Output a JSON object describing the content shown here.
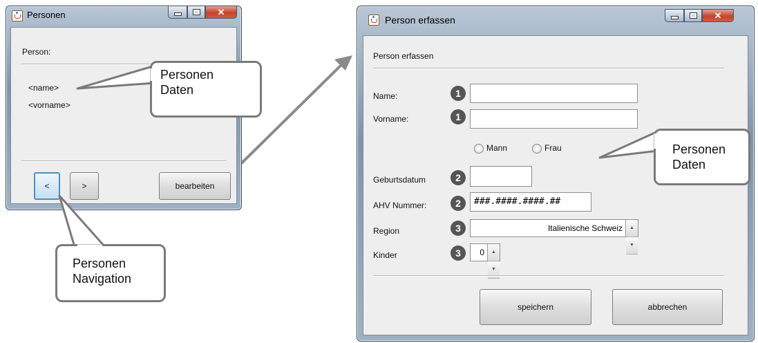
{
  "window1": {
    "title": "Personen",
    "person_label": "Person:",
    "name_placeholder": "<name>",
    "vorname_placeholder": "<vorname>",
    "prev_label": "<",
    "next_label": ">",
    "edit_label": "bearbeiten"
  },
  "window2": {
    "title": "Person erfassen",
    "heading": "Person erfassen",
    "fields": {
      "name_label": "Name:",
      "vorname_label": "Vorname:",
      "mann_label": "Mann",
      "frau_label": "Frau",
      "geburtsdatum_label": "Geburtsdatum",
      "ahv_label": "AHV Nummer:",
      "ahv_value": "###.####.####.##",
      "region_label": "Region",
      "region_value": "Italienische Schweiz",
      "kinder_label": "Kinder",
      "kinder_value": "0"
    },
    "badges": {
      "name": "1",
      "vorname": "1",
      "geburtsdatum": "2",
      "ahv": "2",
      "region": "3",
      "kinder": "3"
    },
    "save_label": "speichern",
    "cancel_label": "abbrechen"
  },
  "callouts": {
    "personen_daten_left": [
      "Personen",
      "Daten"
    ],
    "personen_navigation": [
      "Personen",
      "Navigation"
    ],
    "personen_daten_right": [
      "Personen",
      "Daten"
    ]
  },
  "colors": {
    "titlebar": "#9fb1c4",
    "close_button": "#c5432b",
    "client_bg": "#eeeeee",
    "callout_border": "#7a7a7a",
    "badge": "#555555"
  }
}
